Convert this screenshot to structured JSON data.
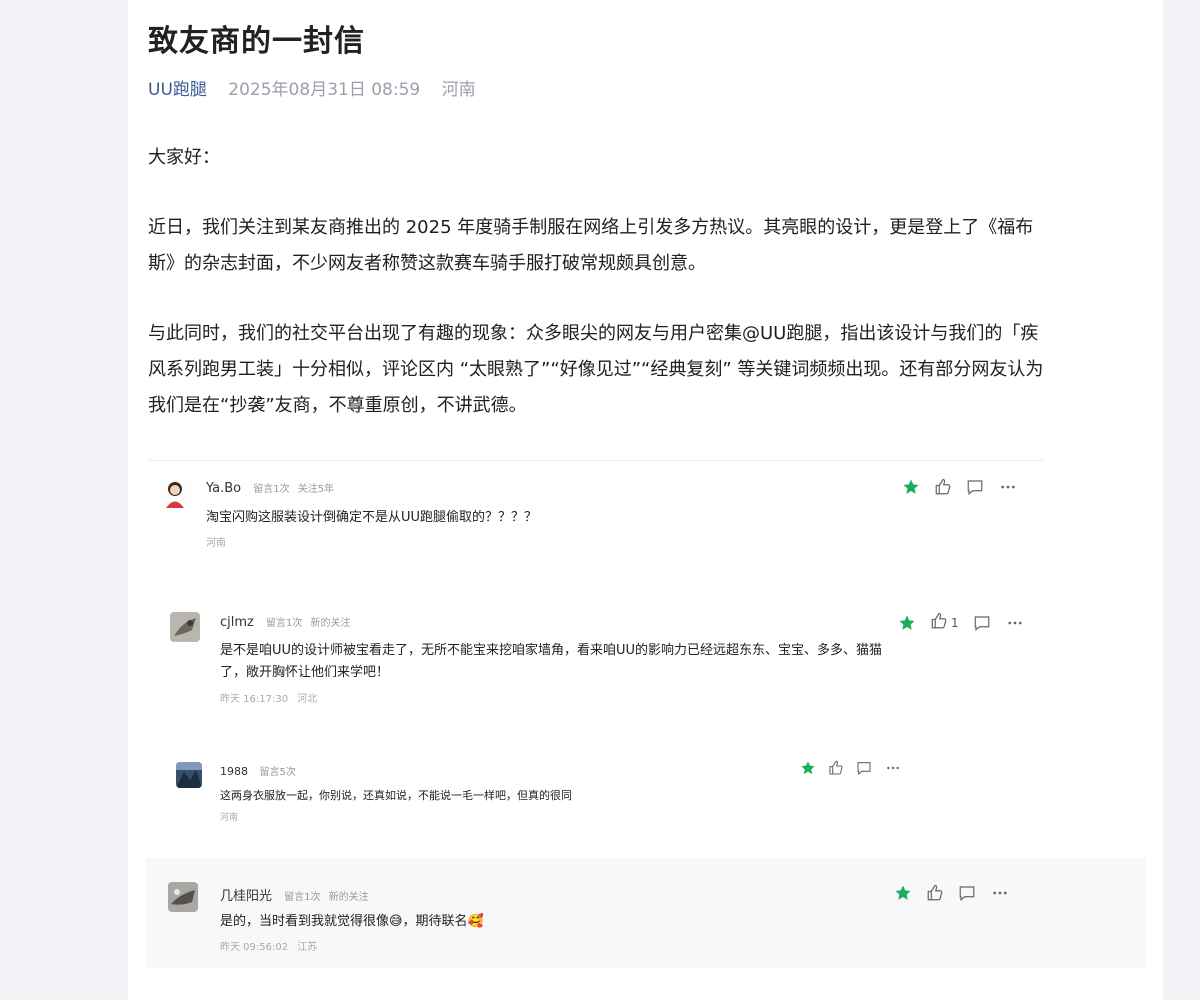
{
  "article": {
    "title": "致友商的一封信",
    "author": "UU跑腿",
    "date": "2025年08月31日 08:59",
    "location": "河南",
    "paragraphs": [
      "大家好：",
      "近日，我们关注到某友商推出的 2025 年度骑手制服在网络上引发多方热议。其亮眼的设计，更是登上了《福布斯》的杂志封面，不少网友者称赞这款赛车骑手服打破常规颇具创意。",
      "与此同时，我们的社交平台出现了有趣的现象：众多眼尖的网友与用户密集@UU跑腿，指出该设计与我们的「疾风系列跑男工装」十分相似，评论区内 “太眼熟了”“好像见过”“经典复刻” 等关键词频频出现。还有部分网友认为我们是在“抄袭”友商，不尊重原创，不讲武德。"
    ]
  },
  "comments": [
    {
      "name": "Ya.Bo",
      "tag1": "留言1次",
      "tag2": "关注5年",
      "text": "淘宝闪购这服装设计倒确定不是从UU跑腿偷取的？？？？",
      "time": "",
      "place": "河南",
      "like_count": ""
    },
    {
      "name": "cjlmz",
      "tag1": "留言1次",
      "tag2": "新的关注",
      "text": "是不是咱UU的设计师被宝看走了，无所不能宝来挖咱家墙角，看来咱UU的影响力已经远超东东、宝宝、多多、猫猫了，敞开胸怀让他们来学吧！",
      "time": "昨天 16:17:30",
      "place": "河北",
      "like_count": "1"
    },
    {
      "name": "1988",
      "tag1": "留言5次",
      "tag2": "",
      "text": "这两身衣服放一起，你别说，还真如说，不能说一毛一样吧，但真的很同",
      "time": "",
      "place": "河南",
      "like_count": ""
    },
    {
      "name": "几桂阳光",
      "tag1": "留言1次",
      "tag2": "新的关注",
      "text": "是的，当时看到我就觉得很像😅，期待联名🥰",
      "time": "昨天 09:56:02",
      "place": "江苏",
      "like_count": ""
    }
  ],
  "icons": {
    "star": "star-icon",
    "like": "thumb-up-icon",
    "comment": "comment-icon",
    "more": "more-icon"
  },
  "colors": {
    "star": "#1aad5c",
    "author_link": "#3b5998"
  }
}
